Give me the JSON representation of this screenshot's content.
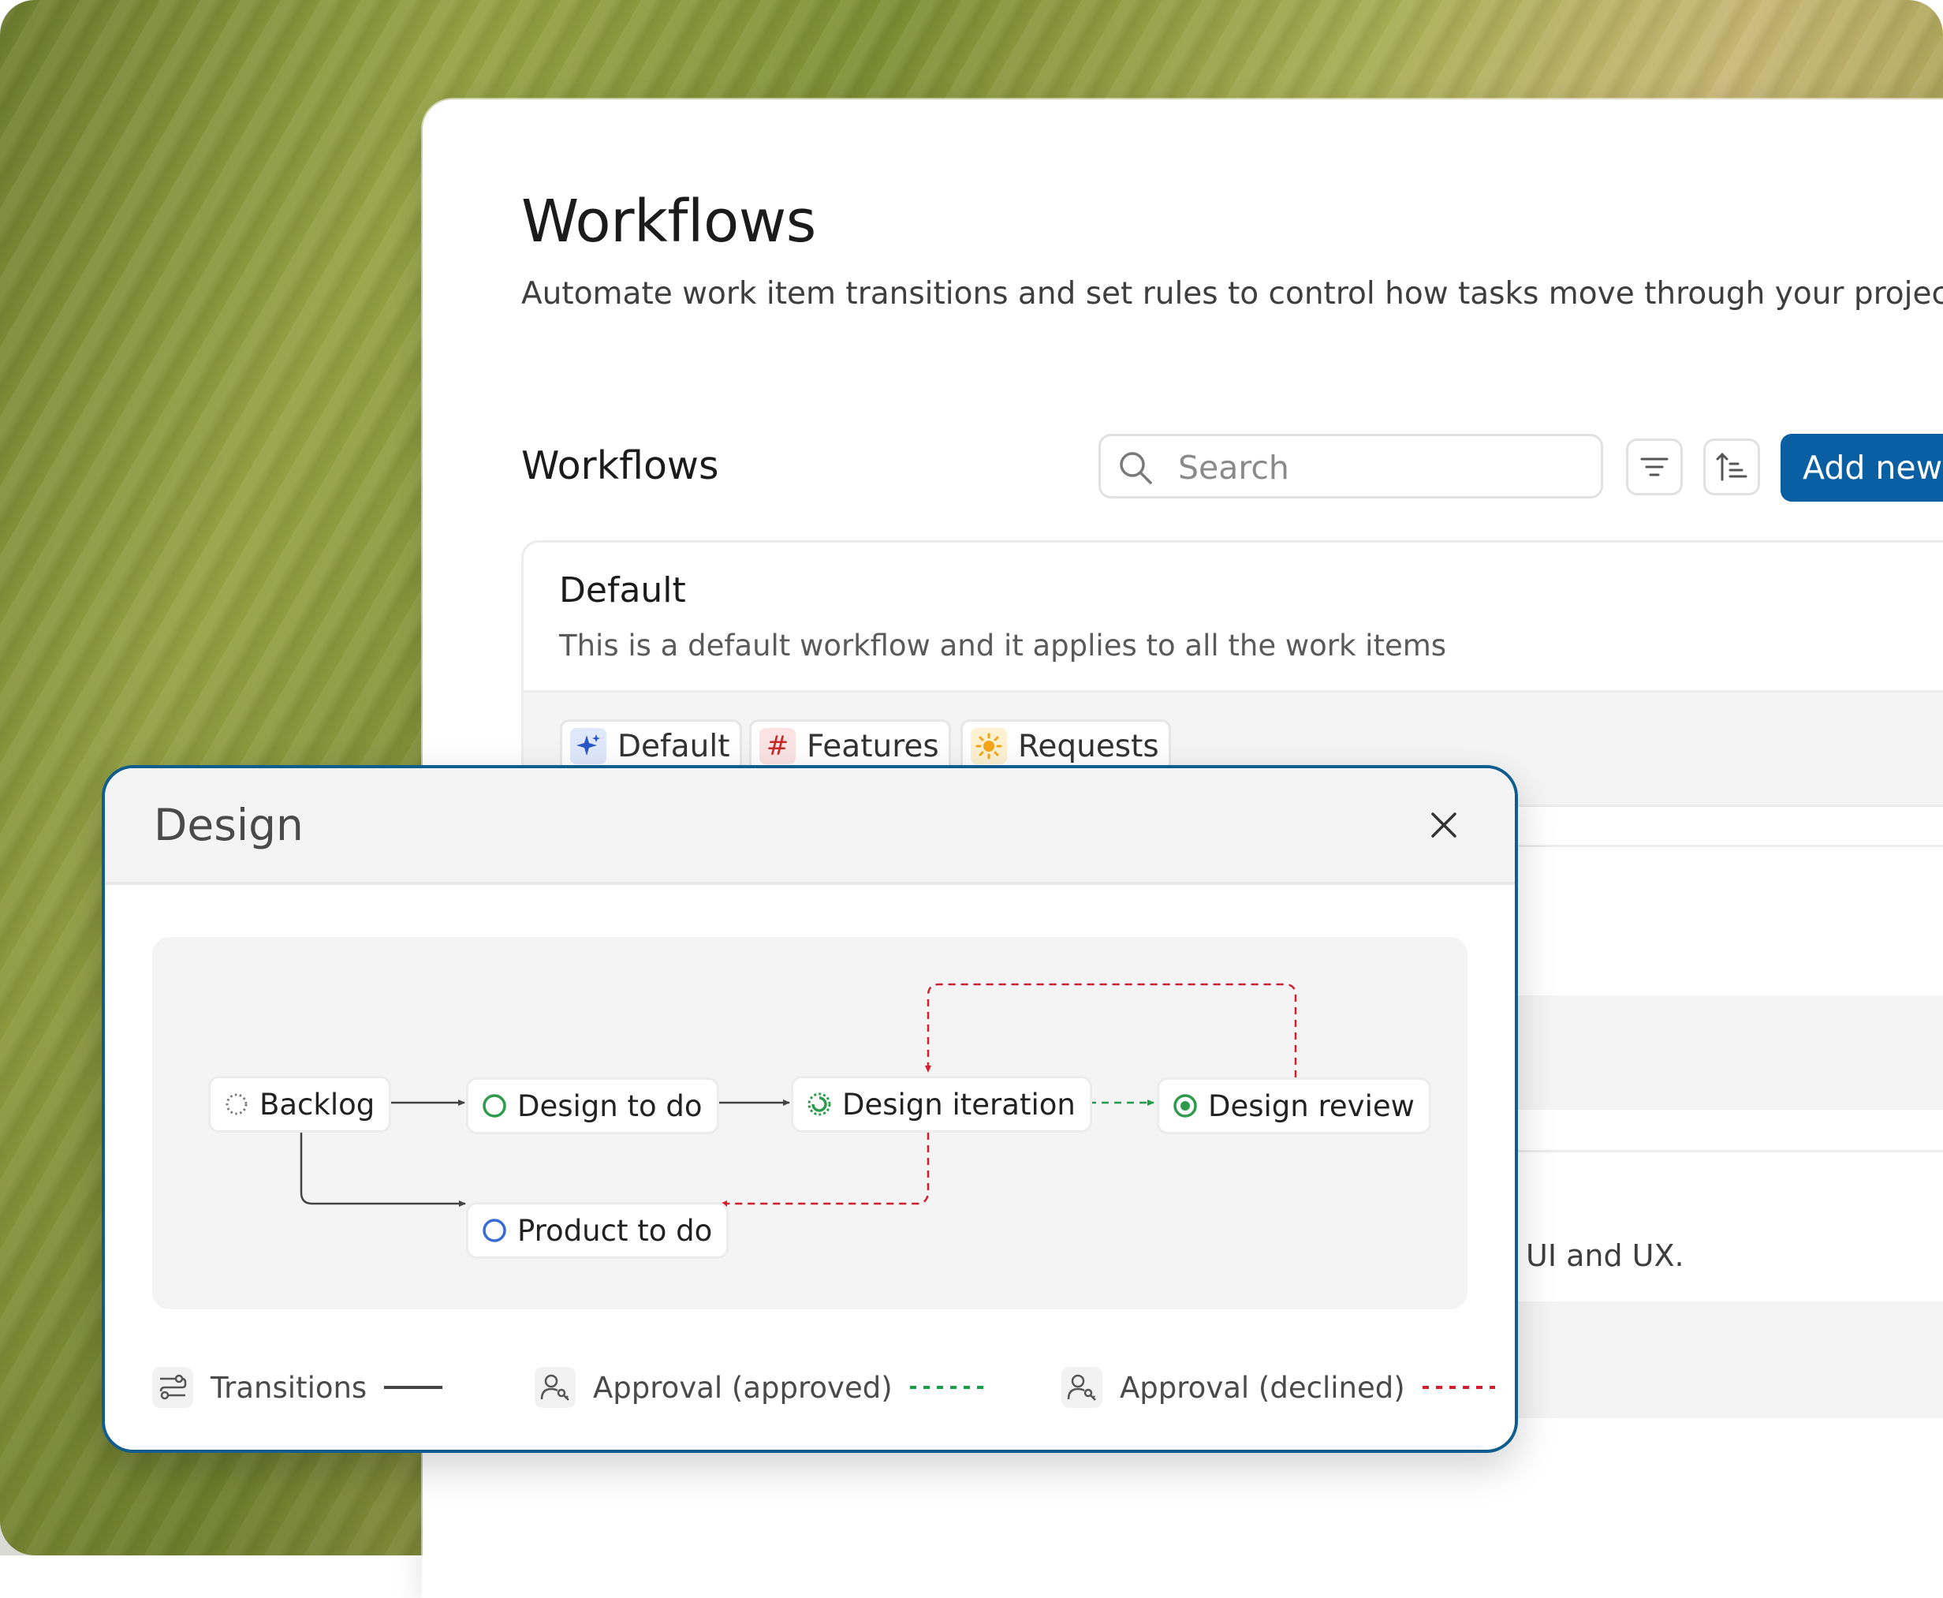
{
  "page": {
    "title": "Workflows",
    "subtitle": "Automate work item transitions and set rules to control how tasks move through your project"
  },
  "toolbar": {
    "section_title": "Workflows",
    "search_placeholder": "Search",
    "filter_icon": "filter-icon",
    "sort_icon": "sort-icon",
    "add_label": "Add new"
  },
  "card": {
    "title": "Default",
    "description": "This is a default workflow and it applies to all the work items",
    "chips": [
      {
        "label": "Default",
        "icon": "sparkle-icon",
        "color": "#2a56c6"
      },
      {
        "label": "Features",
        "icon": "hash-icon",
        "color": "#c62828"
      },
      {
        "label": "Requests",
        "icon": "sun-icon",
        "color": "#f2a516"
      }
    ]
  },
  "background_row": {
    "text_fragment": "UI and UX."
  },
  "modal": {
    "title": "Design",
    "close_icon": "close-icon",
    "nodes": [
      {
        "label": "Backlog",
        "icon": "dashed-circle-icon"
      },
      {
        "label": "Design to do",
        "icon": "green-circle-icon"
      },
      {
        "label": "Design iteration",
        "icon": "progress-circle-icon"
      },
      {
        "label": "Design review",
        "icon": "target-circle-icon"
      },
      {
        "label": "Product to do",
        "icon": "blue-circle-icon"
      }
    ],
    "legend": [
      {
        "label": "Transitions",
        "icon": "transitions-icon",
        "line": "solid",
        "color": "#444444"
      },
      {
        "label": "Approval (approved)",
        "icon": "approver-icon",
        "line": "dashed",
        "color": "#1e9e4a"
      },
      {
        "label": "Approval (declined)",
        "icon": "approver-icon",
        "line": "dashed",
        "color": "#d01f2e"
      }
    ]
  },
  "colors": {
    "accent": "#0a5fa3",
    "modal_border": "#0f5c8f",
    "approved": "#1e9e4a",
    "declined": "#d01f2e"
  }
}
